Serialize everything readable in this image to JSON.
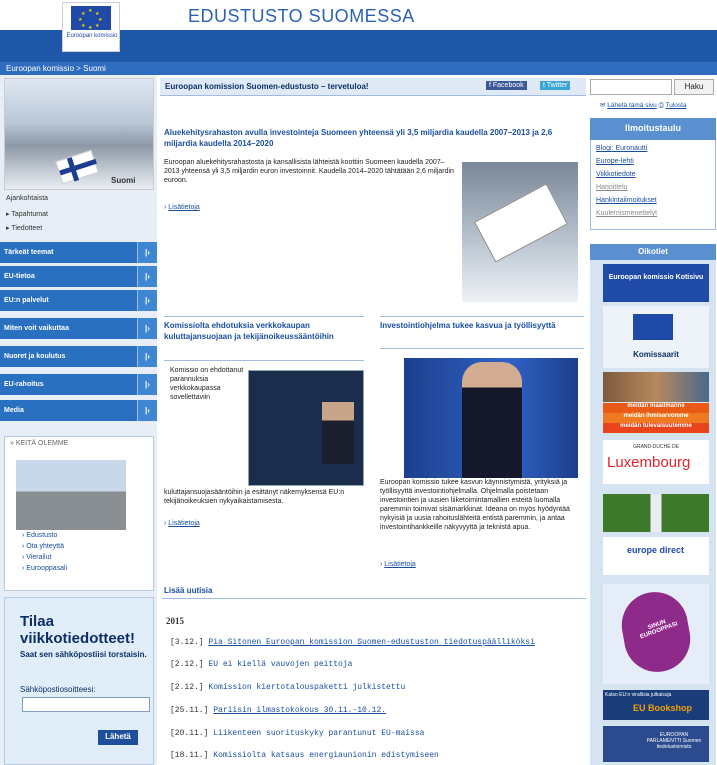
{
  "header": {
    "logo_text": "Euroopan komissio",
    "site_title": "EDUSTUSTO SUOMESSA",
    "breadcrumb": "Euroopan komissio > Suomi"
  },
  "left": {
    "suomi_label": "Suomi",
    "small_nav": [
      "Ajankohtaista",
      "Tapahtumat",
      "Tiedotteet"
    ],
    "menu": [
      "Tärkeät teemat",
      "EU-tietoa",
      "EU:n palvelut",
      "Miten voit vaikuttaa",
      "Nuoret ja koulutus",
      "EU-rahoitus",
      "Media"
    ],
    "keita_title": "KEITÄ OLEMME",
    "keita_links": [
      "Edustusto",
      "Ota yhteyttä",
      "Vierailut",
      "Eurooppasali"
    ],
    "newsletter": {
      "title": "Tilaa viikkotiedotteet!",
      "sub": "Saat sen sähköpostiisi torstaisin.",
      "email_label": "Sähköpostiosoitteesi:",
      "send": "Lähetä"
    }
  },
  "topbar": {
    "welcome": "Euroopan komission Suomen-edustusto – tervetuloa!",
    "facebook": "Facebook",
    "twitter": "Twitter",
    "search_button": "Haku",
    "share": "Lähetä tämä sivu",
    "print": "Tulosta"
  },
  "news": {
    "lead_title": "Aluekehitysrahaston avulla investointeja Suomeen yhteensä yli 3,5 miljardia kaudella 2007–2013 ja 2,6 miljardia kaudella 2014–2020",
    "lead_body": "Euroopan aluekehitysrahastosta ja kansallisista lähteistä koottiin Suomeen kaudella 2007–2013 yhteensä yli 3,5 miljardin euron investoinnit. Kaudella 2014–2020 tähtätään 2,6 miljardin euroon.",
    "lead_more": "Lisätietoja",
    "left_title": "Komissiolta ehdotuksia verkkokaupan kuluttajansuojaan ja tekijänoikeussääntöihin",
    "left_body_top": "Komissio on ehdottanut parannuksia verkkokaupassa sovellettaviin",
    "left_body_bottom": "kuluttajansuojasääntöihin ja esittänyt näkemyksensä EU:n tekijänoikeuksien nykyaikaistamisesta.",
    "left_more": "Lisätietoja",
    "right_title": "Investointiohjelma tukee kasvua ja työllisyyttä",
    "right_body": "Euroopan komissio tukee kasvun käynnistymistä, yrityksiä ja työllisyyttä investointiohjelmalla. Ohjelmalla poistetaan investointien ja uusien liiketoimintamallien esteitä luomalla paremmin toimivat sisämarkkinat. Ideana on myös hyödyntää nykyisiä ja uusia rahoituslähteitä entistä paremmin, ja antaa investointihankkeille näkyvyyttä ja teknistä apua.",
    "right_more": "Lisätietoja",
    "more_news_title": "Lisää uutisia",
    "year": "2015",
    "items": [
      {
        "date": "[3.12.]",
        "text": "Pia Sitonen Euroopan komission Suomen-edustuston tiedotuspäälliköksi"
      },
      {
        "date": "[2.12.]",
        "text": "EU ei kiellä vauvojen peittoja"
      },
      {
        "date": "[2.12.]",
        "text": "Komission kiertotalouspaketti julkistettu"
      },
      {
        "date": "[25.11.]",
        "text": "Pariisin ilmastokokous 30.11.-10.12."
      },
      {
        "date": "[20.11.]",
        "text": "Liikenteen suorituskyky parantunut EU-maissa"
      },
      {
        "date": "[18.11.]",
        "text": "Komissiolta katsaus energiaunionin edistymiseen"
      }
    ]
  },
  "right": {
    "ilmo_title": "Ilmoitustaulu",
    "ilmo_links": [
      "Blogi: Euronautti",
      "Europe-lehti",
      "Viikkotiedote",
      "Harjoittelu",
      "Hankintailmoitukset",
      "Kuulemismenettelyt"
    ],
    "oik_title": "Oikotiet",
    "tiles": {
      "kotisivu": "Euroopan komissio Kotisivu",
      "komissaarit": "Komissaarit",
      "maailmanne": "meidän maailmanne",
      "ihmisarvomme": "meidän ihmisarvomme",
      "tulevaisuutemme": "meidän tulevaisuutemme",
      "lux_top": "GRAND-DUCHÉ DE",
      "lux": "Luxembourg",
      "europe_direct": "europe direct",
      "eurooppasi": "SINUN EUROOPPASI",
      "bookshop": "EU Bookshop",
      "bookshop_top": "Katso EU:n virallisia julkaisuja",
      "parliament": "EUROOPAN PARLAMENTTI Suomen tiedotustoimisto"
    }
  },
  "colors": {
    "primary": "#1f57a8",
    "menu": "#2a70c0",
    "link": "#1a4fa0",
    "accent_orange": "#e85a16"
  }
}
